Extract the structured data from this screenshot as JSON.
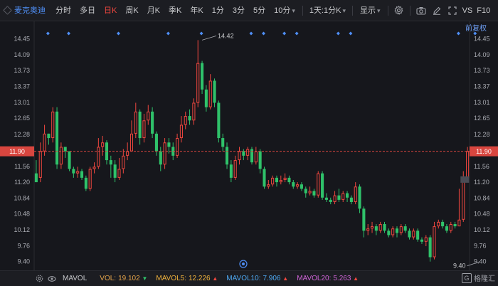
{
  "toolbar": {
    "stock_name": "麦克奥迪",
    "periods": [
      {
        "label": "分时",
        "active": false
      },
      {
        "label": "多日",
        "active": false
      },
      {
        "label": "日K",
        "active": true
      },
      {
        "label": "周K",
        "active": false
      },
      {
        "label": "月K",
        "active": false
      },
      {
        "label": "季K",
        "active": false
      },
      {
        "label": "年K",
        "active": false
      },
      {
        "label": "1分",
        "active": false
      },
      {
        "label": "3分",
        "active": false
      },
      {
        "label": "5分",
        "active": false
      },
      {
        "label": "10分",
        "active": false,
        "dropdown": true
      }
    ],
    "multi_period": "1天:1分K",
    "display": "显示",
    "vs": "VS",
    "f10": "F10"
  },
  "fuquan": "前复权",
  "price_axis": {
    "ticks": [
      "14.45",
      "14.09",
      "13.73",
      "13.37",
      "13.01",
      "12.65",
      "12.28",
      "11.92",
      "11.56",
      "11.20",
      "10.84",
      "10.48",
      "10.12",
      "9.76",
      "9.40"
    ],
    "current_price_label": "11.90",
    "high_label": "14.42",
    "low_label": "9.40"
  },
  "colors": {
    "up": "#f0473f",
    "down": "#2fc26a",
    "background": "#16171c",
    "toolbar": "#1c1d22",
    "accent": "#4f8ff7"
  },
  "chart_data": {
    "type": "candlestick",
    "ylim": [
      9.25,
      14.62
    ],
    "current_price": 11.9,
    "high": {
      "value": 14.42,
      "index": 40
    },
    "low": {
      "value": 9.4,
      "index": 107
    },
    "candles": [
      [
        11.4,
        11.2,
        11.7,
        11.2
      ],
      [
        11.3,
        11.9,
        12.1,
        11.2
      ],
      [
        11.9,
        12.3,
        12.5,
        11.8
      ],
      [
        12.3,
        12.2,
        12.3,
        12.05
      ],
      [
        12.2,
        12.8,
        12.9,
        12.1
      ],
      [
        12.8,
        11.6,
        12.9,
        11.5
      ],
      [
        11.6,
        12.0,
        12.1,
        11.5
      ],
      [
        12.0,
        11.9,
        12.0,
        11.75
      ],
      [
        11.9,
        11.5,
        11.9,
        11.45
      ],
      [
        11.5,
        11.4,
        11.55,
        11.3
      ],
      [
        11.4,
        11.45,
        11.55,
        11.3
      ],
      [
        11.45,
        11.3,
        11.5,
        11.25
      ],
      [
        11.3,
        11.05,
        11.35,
        11.0
      ],
      [
        11.05,
        11.5,
        11.55,
        11.0
      ],
      [
        11.5,
        11.55,
        11.65,
        11.4
      ],
      [
        11.55,
        12.0,
        12.2,
        11.5
      ],
      [
        12.0,
        12.1,
        12.25,
        11.8
      ],
      [
        12.1,
        11.7,
        12.15,
        11.6
      ],
      [
        11.7,
        11.6,
        11.8,
        11.3
      ],
      [
        11.6,
        11.3,
        11.7,
        11.2
      ],
      [
        11.3,
        11.5,
        11.75,
        11.25
      ],
      [
        11.5,
        11.8,
        11.95,
        11.4
      ],
      [
        11.8,
        11.9,
        12.1,
        11.7
      ],
      [
        11.9,
        12.3,
        12.6,
        11.9
      ],
      [
        12.3,
        12.8,
        13.0,
        12.2
      ],
      [
        12.8,
        12.2,
        12.85,
        12.05
      ],
      [
        12.2,
        12.6,
        12.75,
        12.1
      ],
      [
        12.6,
        12.8,
        12.95,
        12.5
      ],
      [
        12.8,
        12.3,
        12.9,
        12.2
      ],
      [
        12.3,
        11.9,
        12.35,
        11.8
      ],
      [
        11.9,
        11.6,
        12.0,
        11.45
      ],
      [
        11.6,
        12.1,
        12.2,
        11.5
      ],
      [
        12.1,
        12.0,
        12.2,
        11.85
      ],
      [
        12.0,
        11.8,
        12.1,
        11.7
      ],
      [
        11.8,
        12.2,
        12.3,
        11.75
      ],
      [
        12.2,
        12.5,
        12.7,
        12.1
      ],
      [
        12.5,
        12.7,
        12.8,
        12.4
      ],
      [
        12.7,
        12.6,
        12.85,
        12.5
      ],
      [
        12.6,
        13.0,
        13.1,
        12.5
      ],
      [
        13.0,
        13.9,
        14.42,
        12.9
      ],
      [
        13.9,
        13.3,
        13.95,
        13.2
      ],
      [
        13.3,
        12.9,
        13.4,
        12.8
      ],
      [
        12.9,
        13.5,
        13.65,
        12.85
      ],
      [
        13.5,
        13.0,
        13.55,
        12.9
      ],
      [
        13.0,
        12.2,
        13.05,
        12.1
      ],
      [
        12.2,
        12.0,
        12.3,
        11.9
      ],
      [
        12.0,
        11.6,
        12.1,
        11.5
      ],
      [
        11.6,
        11.3,
        11.7,
        11.2
      ],
      [
        11.3,
        11.7,
        11.8,
        11.25
      ],
      [
        11.7,
        11.9,
        12.0,
        11.6
      ],
      [
        11.9,
        11.8,
        11.95,
        11.7
      ],
      [
        11.8,
        11.95,
        12.0,
        11.7
      ],
      [
        11.95,
        11.65,
        12.0,
        11.6
      ],
      [
        11.65,
        11.9,
        12.0,
        11.6
      ],
      [
        11.9,
        11.5,
        11.95,
        11.4
      ],
      [
        11.5,
        11.1,
        11.55,
        11.05
      ],
      [
        11.1,
        11.15,
        11.25,
        11.05
      ],
      [
        11.15,
        11.3,
        11.35,
        11.1
      ],
      [
        11.3,
        11.2,
        11.35,
        11.1
      ],
      [
        11.2,
        11.25,
        11.35,
        11.15
      ],
      [
        11.25,
        11.3,
        11.4,
        11.2
      ],
      [
        11.3,
        11.2,
        11.35,
        11.15
      ],
      [
        11.2,
        11.1,
        11.25,
        11.05
      ],
      [
        11.1,
        11.15,
        11.2,
        11.05
      ],
      [
        11.15,
        11.05,
        11.2,
        11.0
      ],
      [
        11.05,
        10.95,
        11.1,
        10.85
      ],
      [
        10.95,
        11.0,
        11.1,
        10.9
      ],
      [
        11.0,
        10.9,
        11.05,
        10.85
      ],
      [
        10.9,
        11.4,
        11.45,
        10.85
      ],
      [
        11.4,
        10.85,
        11.45,
        10.8
      ],
      [
        10.85,
        10.8,
        10.95,
        10.75
      ],
      [
        10.8,
        10.75,
        10.85,
        10.7
      ],
      [
        10.75,
        10.9,
        11.0,
        10.7
      ],
      [
        10.9,
        10.8,
        11.05,
        10.75
      ],
      [
        10.8,
        10.95,
        11.0,
        10.75
      ],
      [
        10.95,
        10.85,
        11.0,
        10.75
      ],
      [
        10.85,
        10.75,
        10.9,
        10.7
      ],
      [
        10.75,
        11.1,
        11.2,
        10.7
      ],
      [
        11.1,
        10.6,
        11.15,
        10.5
      ],
      [
        10.6,
        10.1,
        10.65,
        9.95
      ],
      [
        10.1,
        10.15,
        10.25,
        10.0
      ],
      [
        10.15,
        10.2,
        10.3,
        10.05
      ],
      [
        10.2,
        10.1,
        10.25,
        10.0
      ],
      [
        10.1,
        10.25,
        10.3,
        10.05
      ],
      [
        10.25,
        10.1,
        10.3,
        10.05
      ],
      [
        10.1,
        10.0,
        10.15,
        9.95
      ],
      [
        10.0,
        10.15,
        10.2,
        9.95
      ],
      [
        10.15,
        10.05,
        10.2,
        9.95
      ],
      [
        10.05,
        10.2,
        10.25,
        10.0
      ],
      [
        10.2,
        10.1,
        10.25,
        10.05
      ],
      [
        10.1,
        9.95,
        10.15,
        9.9
      ],
      [
        9.95,
        10.1,
        10.15,
        9.9
      ],
      [
        10.1,
        9.9,
        10.15,
        9.85
      ],
      [
        9.9,
        9.85,
        9.95,
        9.8
      ],
      [
        9.85,
        9.95,
        10.0,
        9.75
      ],
      [
        9.95,
        9.5,
        10.0,
        9.4
      ],
      [
        9.5,
        10.2,
        10.3,
        9.45
      ],
      [
        10.2,
        10.3,
        10.35,
        10.15
      ],
      [
        10.3,
        10.2,
        10.35,
        10.15
      ],
      [
        10.2,
        10.1,
        10.25,
        10.05
      ],
      [
        10.1,
        10.25,
        10.3,
        10.05
      ],
      [
        10.25,
        10.2,
        10.3,
        10.15
      ],
      [
        10.2,
        10.35,
        11.05,
        10.2
      ],
      [
        10.35,
        11.3,
        11.45,
        10.3
      ],
      [
        11.3,
        11.9,
        12.0,
        11.25
      ]
    ]
  },
  "bottombar": {
    "indicator": "MAVOL",
    "vol_label": "VOL:",
    "vol_value": "19.102",
    "vol_trend": "down",
    "m5_label": "MAVOL5:",
    "m5_value": "12.226",
    "m5_trend": "up",
    "m10_label": "MAVOL10:",
    "m10_value": "7.906",
    "m10_trend": "up",
    "m20_label": "MAVOL20:",
    "m20_value": "5.263",
    "m20_trend": "up",
    "watermark": "格隆汇",
    "watermark_mark": "G"
  }
}
